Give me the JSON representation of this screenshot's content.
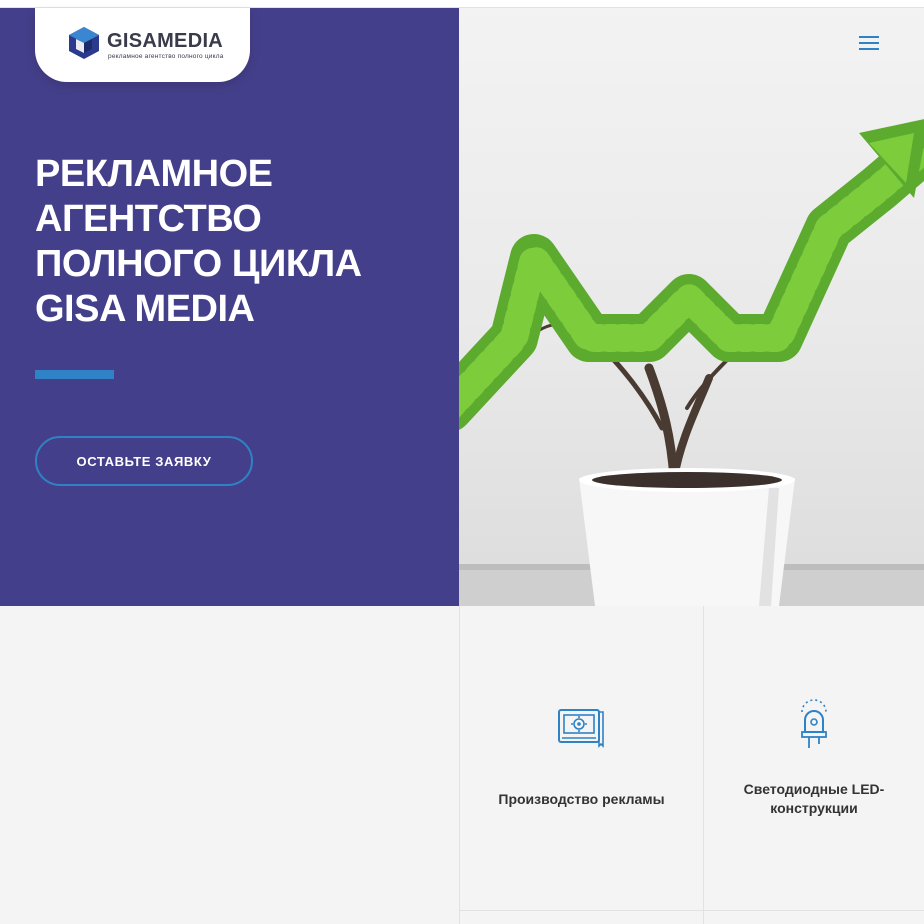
{
  "header": {
    "logo_name": "GISAMEDIA",
    "logo_tagline": "рекламное агентство полного цикла",
    "logo_icon": "gisamedia-logo-mark",
    "menu_icon": "hamburger-menu-icon"
  },
  "hero": {
    "title_lines": [
      "РЕКЛАМНОЕ",
      "АГЕНТСТВО",
      "ПОЛНОГО ЦИКЛА",
      "GISA MEDIA"
    ],
    "cta_label": "ОСТАВЬТЕ ЗАЯВКУ",
    "image": "potted-plant-growth-arrow"
  },
  "features": [
    {
      "label": "Производство рекламы",
      "icon": "blueprint-gear-icon"
    },
    {
      "label": "Светодиодные LED-конструкции",
      "icon": "led-diode-icon"
    }
  ],
  "colors": {
    "hero_background": "#443f8a",
    "accent": "#2f82c6",
    "page_background": "#f4f4f4",
    "text_dark": "#333333"
  }
}
